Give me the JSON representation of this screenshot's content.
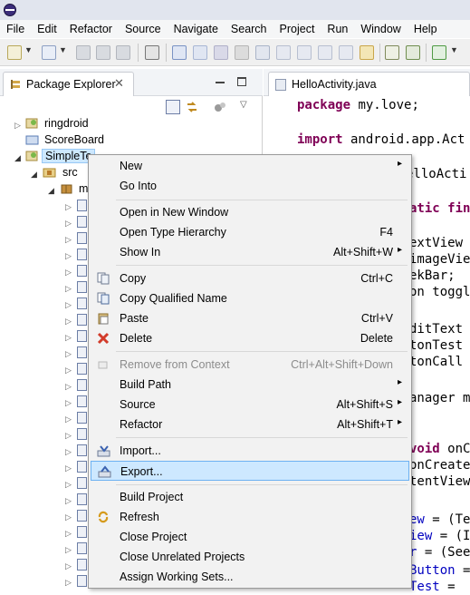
{
  "menubar": [
    "File",
    "Edit",
    "Refactor",
    "Source",
    "Navigate",
    "Search",
    "Project",
    "Run",
    "Window",
    "Help"
  ],
  "package_explorer": {
    "title": "Package Explorer",
    "close": "✕",
    "tree": {
      "ringdroid": "ringdroid",
      "scoreboard": "ScoreBoard",
      "simpletest": "SimpleTe",
      "src": "src",
      "package_partial": "m"
    }
  },
  "editor": {
    "tab_title": "HelloActivity.java",
    "lines": {
      "l1_kw": "package",
      "l1_rest": " my.love;",
      "l2_kw": "import",
      "l2_rest": " android.app.Act",
      "l3": "elloActi",
      "l4_kw": "atic fin",
      "l5": "extView",
      "l6": "imageVie",
      "l7": "ekBar;",
      "l8": "on toggl",
      "l9": "ditText",
      "l10": "tonTest",
      "l11": "tonCall",
      "l12": "anager m",
      "l13_kw": "void",
      "l13_rest": " onC",
      "l14": "onCreate",
      "l15": "tentView",
      "l16_f": "ew",
      "l16_r": " = (Te",
      "l17_f": "iew",
      "l17_r": " = (I",
      "l18_f": "r",
      "l18_r": " = (See",
      "l19_f": "Button",
      "l19_r": " =",
      "l20_f": "Test",
      "l20_r": " ="
    }
  },
  "context_menu": {
    "items": {
      "new": {
        "label": "New",
        "shortcut": "",
        "arrow": "▸"
      },
      "go_into": {
        "label": "Go Into",
        "shortcut": ""
      },
      "open_new_window": {
        "label": "Open in New Window",
        "shortcut": ""
      },
      "open_type_hierarchy": {
        "label": "Open Type Hierarchy",
        "shortcut": "F4"
      },
      "show_in": {
        "label": "Show In",
        "shortcut": "Alt+Shift+W",
        "arrow": "▸"
      },
      "copy": {
        "label": "Copy",
        "shortcut": "Ctrl+C"
      },
      "copy_qualified": {
        "label": "Copy Qualified Name",
        "shortcut": ""
      },
      "paste": {
        "label": "Paste",
        "shortcut": "Ctrl+V"
      },
      "delete": {
        "label": "Delete",
        "shortcut": "Delete"
      },
      "remove_context": {
        "label": "Remove from Context",
        "shortcut": "Ctrl+Alt+Shift+Down"
      },
      "build_path": {
        "label": "Build Path",
        "shortcut": "",
        "arrow": "▸"
      },
      "source": {
        "label": "Source",
        "shortcut": "Alt+Shift+S",
        "arrow": "▸"
      },
      "refactor": {
        "label": "Refactor",
        "shortcut": "Alt+Shift+T",
        "arrow": "▸"
      },
      "import": {
        "label": "Import...",
        "shortcut": ""
      },
      "export": {
        "label": "Export...",
        "shortcut": ""
      },
      "build_project": {
        "label": "Build Project",
        "shortcut": ""
      },
      "refresh": {
        "label": "Refresh",
        "shortcut": ""
      },
      "close_project": {
        "label": "Close Project",
        "shortcut": ""
      },
      "close_unrelated": {
        "label": "Close Unrelated Projects",
        "shortcut": ""
      },
      "assign_sets": {
        "label": "Assign Working Sets...",
        "shortcut": ""
      }
    }
  },
  "colors": {
    "keyword": "#7f0055",
    "field": "#0000c0",
    "selection": "#cde8ff"
  }
}
